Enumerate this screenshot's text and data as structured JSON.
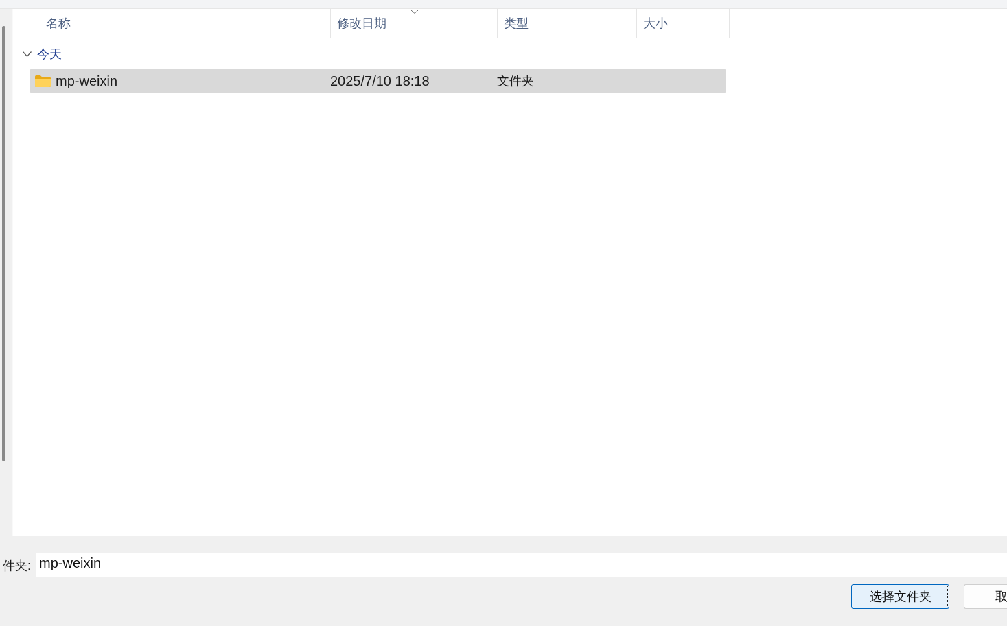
{
  "columns": [
    {
      "label": "名称",
      "sorted": false
    },
    {
      "label": "修改日期",
      "sorted": true
    },
    {
      "label": "类型",
      "sorted": false
    },
    {
      "label": "大小",
      "sorted": false
    }
  ],
  "groups": [
    {
      "label": "今天",
      "expanded": true,
      "items": [
        {
          "name": "mp-weixin",
          "modified": "2025/7/10 18:18",
          "type": "文件夹",
          "selected": true
        }
      ]
    }
  ],
  "folder_field": {
    "label": "件夹:",
    "value": "mp-weixin"
  },
  "buttons": [
    {
      "label": "选择文件夹",
      "default": true
    },
    {
      "label": "取",
      "default": false
    }
  ]
}
